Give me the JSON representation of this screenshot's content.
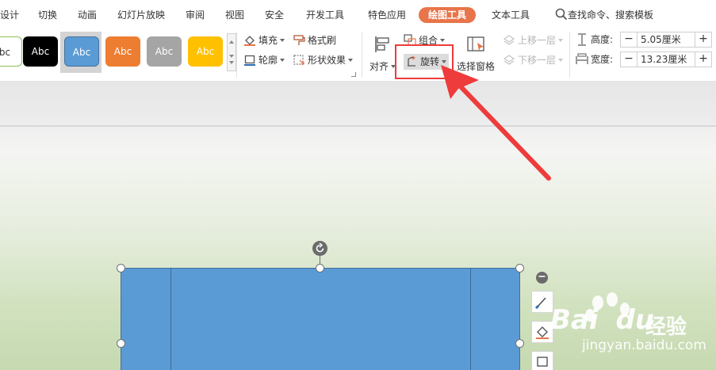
{
  "menubar": {
    "items": [
      "设计",
      "切换",
      "动画",
      "幻灯片放映",
      "审阅",
      "视图",
      "安全",
      "开发工具",
      "特色应用",
      "绘图工具",
      "文本工具"
    ],
    "active": "绘图工具",
    "search_label": "查找命令、搜索模板"
  },
  "ribbon": {
    "styles": [
      {
        "label": "bc",
        "bg": "#ffffff",
        "fg": "#333333",
        "border": "#8fbd5a"
      },
      {
        "label": "Abc",
        "bg": "#000000",
        "fg": "#ffffff"
      },
      {
        "label": "Abc",
        "bg": "#5b9bd5",
        "fg": "#ffffff",
        "selected": true
      },
      {
        "label": "Abc",
        "bg": "#ed7d31",
        "fg": "#ffffff"
      },
      {
        "label": "Abc",
        "bg": "#a5a5a5",
        "fg": "#ffffff"
      },
      {
        "label": "Abc",
        "bg": "#ffc000",
        "fg": "#ffffff"
      }
    ],
    "fill_label": "填充",
    "format_painter_label": "格式刷",
    "outline_label": "轮廓",
    "shape_effects_label": "形状效果",
    "align_label": "对齐",
    "group_label": "组合",
    "rotate_label": "旋转",
    "selection_pane_label": "选择窗格",
    "bring_forward_label": "上移一层",
    "send_backward_label": "下移一层",
    "height_label": "高度:",
    "height_value": "5.05厘米",
    "width_label": "宽度:",
    "width_value": "13.23厘米",
    "minus": "−",
    "plus": "+"
  },
  "annotation": {
    "color": "#ee3b3b"
  },
  "shape": {
    "fill": "#5b9bd5"
  },
  "watermark": {
    "brand": "Bai",
    "brand_suffix": "du",
    "cn": "经验",
    "url": "jingyan.baidu.com"
  }
}
